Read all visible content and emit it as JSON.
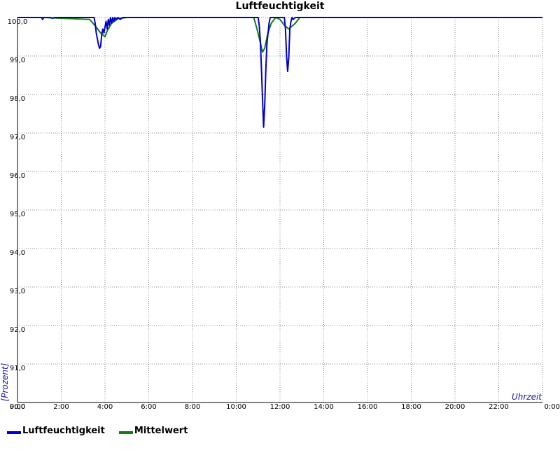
{
  "chart_data": {
    "type": "line",
    "title": "Luftfeuchtigkeit",
    "xlabel": "Uhrzeit",
    "ylabel": "[Prozent]",
    "ylim": [
      90,
      100
    ],
    "xlim": [
      0,
      24
    ],
    "grid": true,
    "legend_position": "bottom-left",
    "x_ticks": [
      "0:00",
      "2:00",
      "4:00",
      "6:00",
      "8:00",
      "10:00",
      "12:00",
      "14:00",
      "16:00",
      "18:00",
      "20:00",
      "22:00",
      "0:00"
    ],
    "y_ticks": [
      "90,0",
      "91,0",
      "92,0",
      "93,0",
      "94,0",
      "95,0",
      "96,0",
      "97,0",
      "98,0",
      "99,0",
      "100,0"
    ],
    "series": [
      {
        "name": "Luftfeuchtigkeit",
        "color": "#0000cc",
        "points": [
          [
            0.0,
            100.0
          ],
          [
            1.1,
            100.0
          ],
          [
            1.15,
            99.95
          ],
          [
            1.2,
            100.0
          ],
          [
            1.5,
            100.0
          ],
          [
            1.6,
            99.98
          ],
          [
            1.7,
            100.0
          ],
          [
            3.5,
            100.0
          ],
          [
            3.55,
            99.85
          ],
          [
            3.6,
            99.6
          ],
          [
            3.65,
            99.45
          ],
          [
            3.7,
            99.3
          ],
          [
            3.75,
            99.2
          ],
          [
            3.8,
            99.25
          ],
          [
            3.85,
            99.55
          ],
          [
            3.9,
            99.7
          ],
          [
            3.95,
            99.6
          ],
          [
            4.0,
            99.75
          ],
          [
            4.05,
            99.9
          ],
          [
            4.1,
            99.7
          ],
          [
            4.15,
            99.95
          ],
          [
            4.2,
            99.8
          ],
          [
            4.25,
            100.0
          ],
          [
            4.3,
            99.85
          ],
          [
            4.35,
            100.0
          ],
          [
            4.4,
            99.9
          ],
          [
            4.45,
            100.0
          ],
          [
            4.5,
            99.95
          ],
          [
            4.6,
            100.0
          ],
          [
            4.7,
            99.95
          ],
          [
            4.8,
            100.0
          ],
          [
            11.0,
            100.0
          ],
          [
            11.05,
            99.8
          ],
          [
            11.1,
            99.4
          ],
          [
            11.15,
            98.7
          ],
          [
            11.2,
            97.9
          ],
          [
            11.25,
            97.15
          ],
          [
            11.3,
            97.7
          ],
          [
            11.35,
            98.6
          ],
          [
            11.4,
            99.3
          ],
          [
            11.5,
            99.85
          ],
          [
            11.55,
            100.0
          ],
          [
            12.2,
            100.0
          ],
          [
            12.25,
            99.7
          ],
          [
            12.3,
            99.0
          ],
          [
            12.35,
            98.6
          ],
          [
            12.4,
            98.95
          ],
          [
            12.45,
            99.7
          ],
          [
            12.5,
            99.9
          ],
          [
            12.55,
            100.0
          ],
          [
            12.6,
            99.95
          ],
          [
            12.7,
            100.0
          ],
          [
            24.0,
            100.0
          ]
        ]
      },
      {
        "name": "Mittelwert",
        "color": "#1a7a1a",
        "points": [
          [
            0.0,
            100.0
          ],
          [
            1.2,
            100.0
          ],
          [
            3.3,
            99.95
          ],
          [
            3.6,
            99.75
          ],
          [
            3.8,
            99.6
          ],
          [
            4.0,
            99.5
          ],
          [
            4.1,
            99.65
          ],
          [
            4.3,
            99.85
          ],
          [
            4.6,
            99.97
          ],
          [
            5.0,
            100.0
          ],
          [
            10.8,
            100.0
          ],
          [
            10.95,
            99.7
          ],
          [
            11.1,
            99.35
          ],
          [
            11.2,
            99.1
          ],
          [
            11.3,
            99.2
          ],
          [
            11.45,
            99.6
          ],
          [
            11.6,
            99.85
          ],
          [
            11.8,
            100.0
          ],
          [
            12.0,
            99.95
          ],
          [
            12.2,
            99.8
          ],
          [
            12.4,
            99.7
          ],
          [
            12.7,
            99.85
          ],
          [
            12.9,
            100.0
          ],
          [
            24.0,
            100.0
          ]
        ]
      }
    ]
  },
  "legend": {
    "items": [
      {
        "label": "Luftfeuchtigkeit",
        "color": "#0000cc"
      },
      {
        "label": "Mittelwert",
        "color": "#1a7a1a"
      }
    ]
  }
}
